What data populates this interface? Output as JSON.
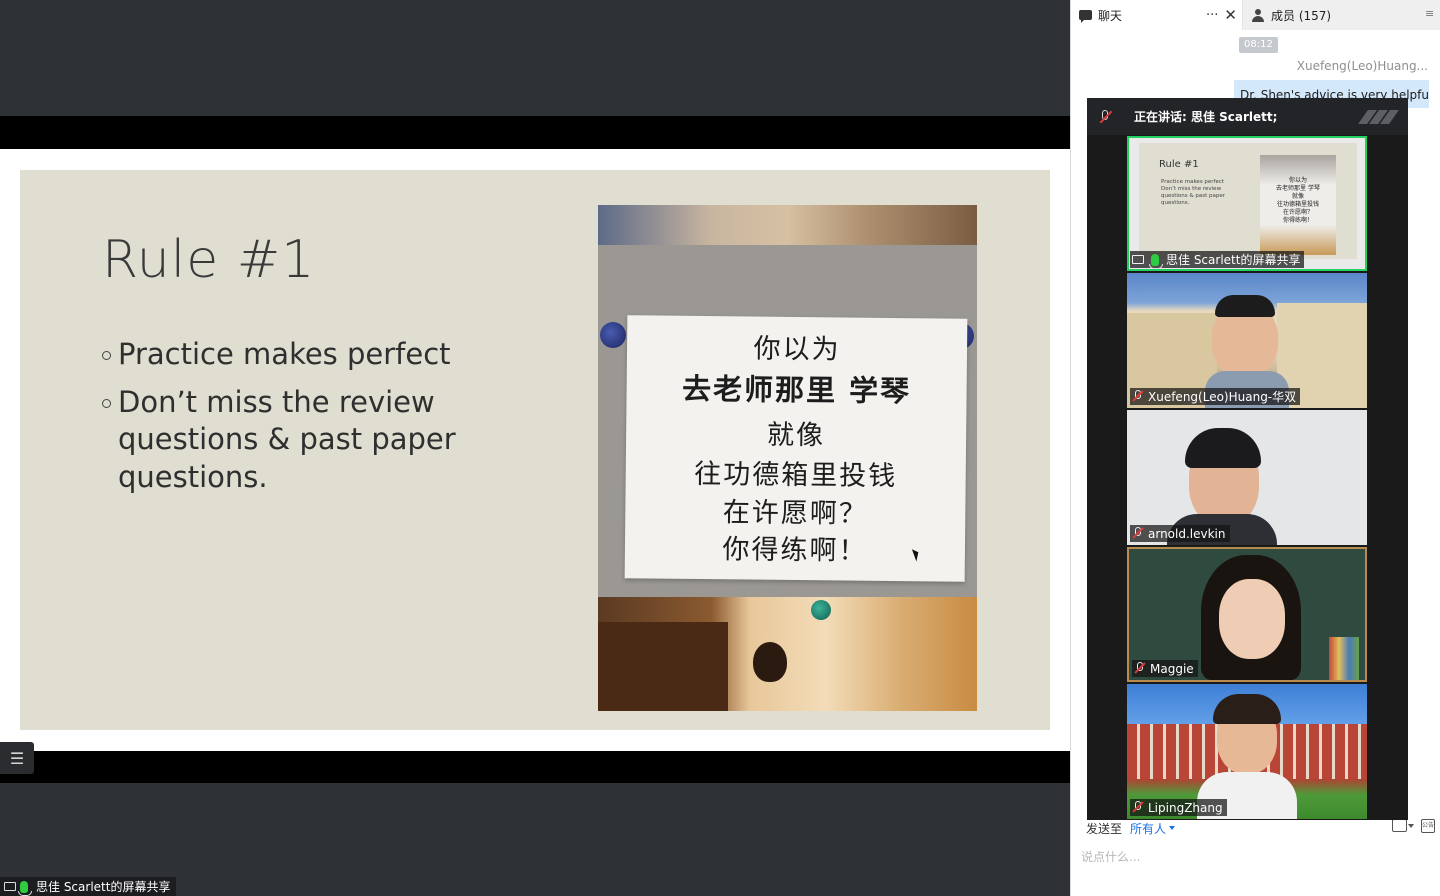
{
  "share": {
    "slide": {
      "title": "Rule #1",
      "bullets": [
        "Practice makes perfect",
        "Don’t miss the review questions & past paper questions."
      ],
      "photo_note_lines": [
        "你以为",
        "去老师那里 学琴",
        "就像",
        "往功德箱里投钱",
        "在许愿啊？",
        "你得练啊！"
      ],
      "photo_note_emphasis": "老师那里",
      "photo_note_emphasis_2": "学琴"
    },
    "sharer_label": "思佳 Scarlett的屏幕共享",
    "list_icon": "list-icon"
  },
  "panel": {
    "tab_chat": "聊天",
    "tab_chat_more": "···",
    "tab_chat_close": "✕",
    "tab_members": "成员 (157)",
    "chat": {
      "time": "08:12",
      "sender": "Xuefeng(Leo)Huang...",
      "message": "Dr. Shen's advice is very helpful!"
    },
    "send_to_label": "发送至",
    "send_to_value": "所有人",
    "input_placeholder": "说点什么..."
  },
  "gallery": {
    "speaking_label": "正在讲话: 思佳 Scarlett;",
    "tiles": [
      {
        "name": "思佳 Scarlett的屏幕共享",
        "mini_title": "Rule #1",
        "mini_text": "Practice makes perfect Don’t miss the review questions & past paper questions.",
        "mini_photo_text": [
          "你以为",
          "去老师那里 学琴",
          "就像",
          "往功德箱里投钱",
          "在许愿啊？",
          "你得练啊！"
        ]
      },
      {
        "name": "Xuefeng(Leo)Huang-华双"
      },
      {
        "name": "arnold.levkin"
      },
      {
        "name": "Maggie"
      },
      {
        "name": "LipingZhang"
      }
    ]
  },
  "colors": {
    "active_speaker": "#23d160",
    "bubble": "#d4e8fb",
    "link": "#1a73e8",
    "slide_bg": "#e0ddd1"
  }
}
